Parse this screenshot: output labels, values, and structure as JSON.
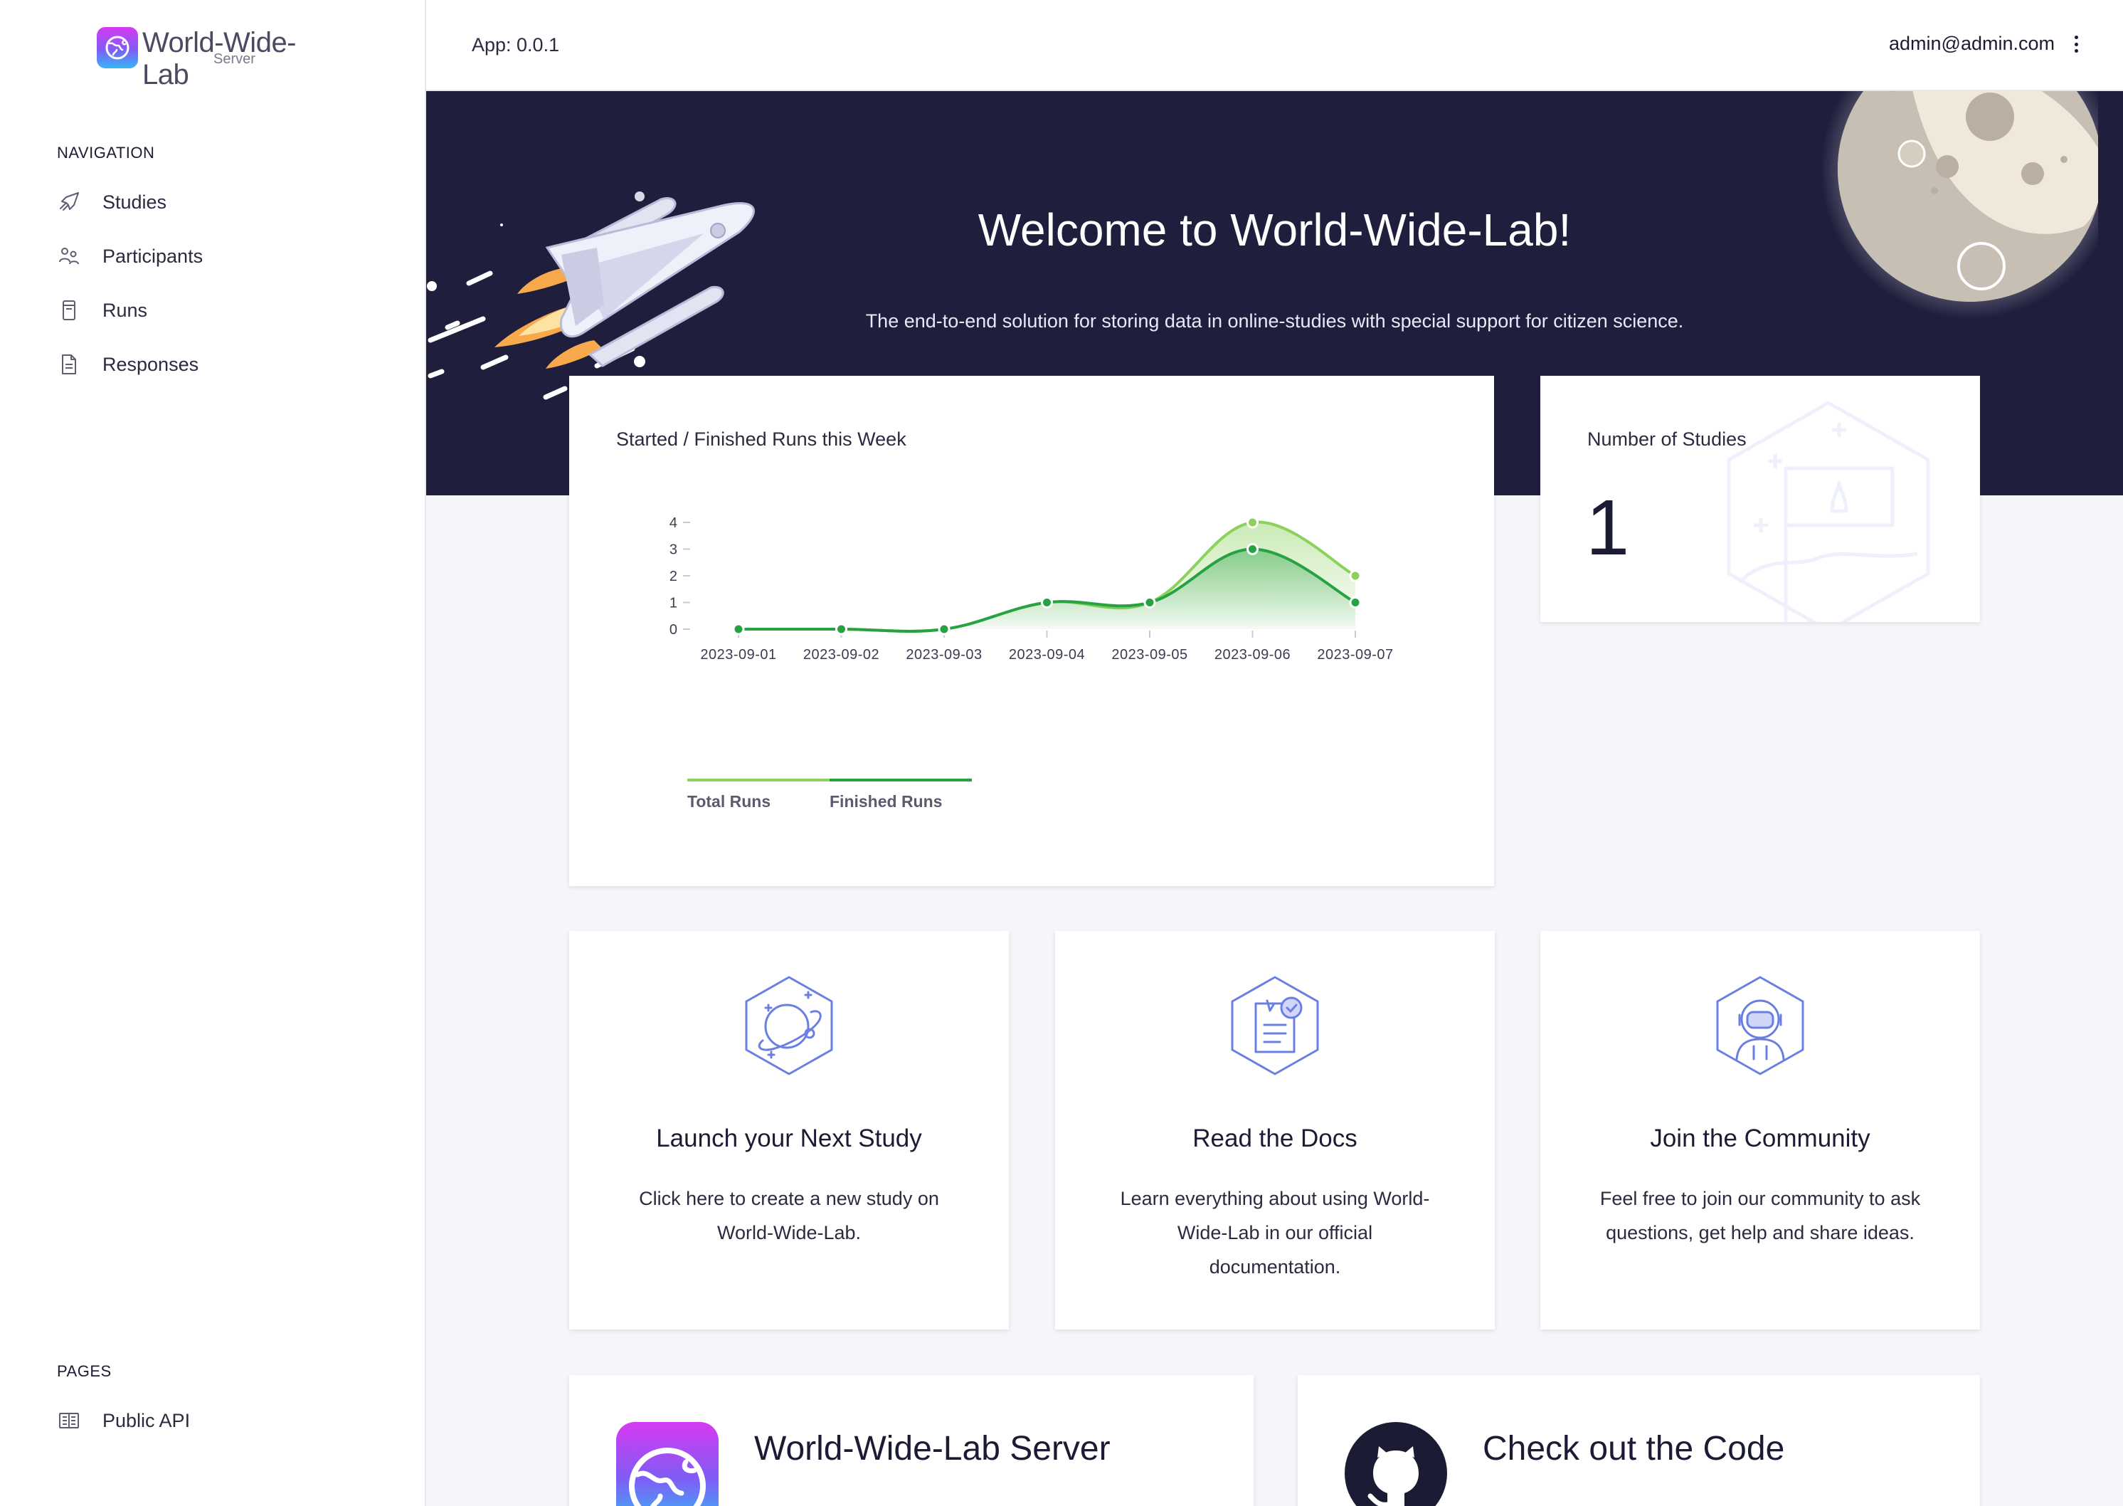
{
  "sidebar": {
    "logo_title": "World-Wide-Lab",
    "logo_subtitle": "Server",
    "nav_heading": "NAVIGATION",
    "items": [
      {
        "label": "Studies",
        "icon": "rocket-icon"
      },
      {
        "label": "Participants",
        "icon": "users-icon"
      },
      {
        "label": "Runs",
        "icon": "runs-icon"
      },
      {
        "label": "Responses",
        "icon": "document-icon"
      }
    ],
    "pages_heading": "PAGES",
    "pages": [
      {
        "label": "Public API",
        "icon": "api-icon"
      }
    ]
  },
  "topbar": {
    "app_version": "App: 0.0.1",
    "user_email": "admin@admin.com"
  },
  "hero": {
    "title": "Welcome to World-Wide-Lab!",
    "subtitle": "The end-to-end solution for storing data in online-studies with special support for citizen science."
  },
  "runs_card": {
    "title": "Started / Finished Runs this Week"
  },
  "chart_data": {
    "type": "area",
    "title": "Started / Finished Runs this Week",
    "categories": [
      "2023-09-01",
      "2023-09-02",
      "2023-09-03",
      "2023-09-04",
      "2023-09-05",
      "2023-09-06",
      "2023-09-07"
    ],
    "series": [
      {
        "name": "Total Runs",
        "values": [
          0,
          0,
          0,
          1,
          1,
          4,
          2
        ],
        "color": "#8bd15c"
      },
      {
        "name": "Finished Runs",
        "values": [
          0,
          0,
          0,
          1,
          1,
          3,
          1
        ],
        "color": "#27a243"
      }
    ],
    "yticks": [
      0,
      1,
      2,
      3,
      4
    ],
    "ylim": [
      0,
      4
    ],
    "legend": "bottom-left",
    "grid": false
  },
  "studies_card": {
    "label": "Number of Studies",
    "count": "1"
  },
  "features": [
    {
      "title": "Launch your Next Study",
      "description": "Click here to create a new study on World-Wide-Lab.",
      "icon": "planet-icon"
    },
    {
      "title": "Read the Docs",
      "description": "Learn everything about using World-Wide-Lab in our official documentation.",
      "icon": "docs-icon"
    },
    {
      "title": "Join the Community",
      "description": "Feel free to join our community to ask questions, get help and share ideas.",
      "icon": "astronaut-icon"
    }
  ],
  "bottom_cards": [
    {
      "title": "World-Wide-Lab Server",
      "icon": "wwl-logo-icon"
    },
    {
      "title": "Check out the Code",
      "icon": "github-icon"
    }
  ],
  "colors": {
    "hero_bg": "#1f1f3d",
    "accent_total": "#8bd15c",
    "accent_finished": "#27a243",
    "brand_gradient_top": "#d63af2",
    "brand_gradient_bottom": "#37b6f6",
    "icon_stroke": "#6b7fe3"
  }
}
